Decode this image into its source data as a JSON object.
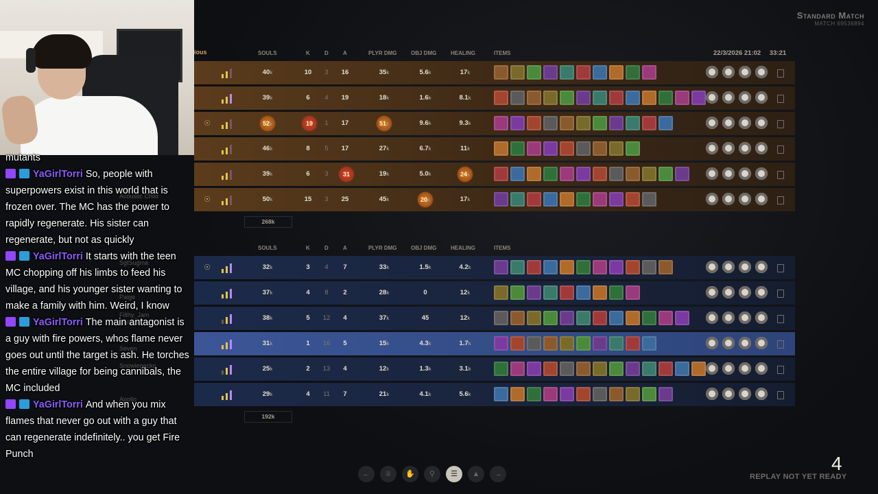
{
  "match": {
    "title": "Standard Match",
    "id": "MATCH 69536894",
    "date": "22/3/2026 21:02",
    "duration": "33:21",
    "team_a_label": "ious"
  },
  "columns": {
    "souls": "SOULS",
    "k": "K",
    "d": "D",
    "a": "A",
    "player_damage": "PLYR DMG",
    "objective_damage": "OBJ DMG",
    "healing": "HEALING",
    "items": "ITEMS"
  },
  "team_a": {
    "total_souls": "268k",
    "players": [
      {
        "souls": "40",
        "k": "10",
        "d": "3",
        "a": "16",
        "pd": "35",
        "od": "5.6",
        "h": "17",
        "bars": [
          1,
          1,
          0
        ]
      },
      {
        "souls": "39",
        "k": "6",
        "d": "4",
        "a": "19",
        "pd": "18",
        "od": "1.6",
        "h": "8.1",
        "bars": [
          1,
          1,
          1
        ]
      },
      {
        "souls": "52",
        "k": "19",
        "d": "1",
        "a": "17",
        "pd": "51",
        "od": "9.6",
        "h": "9.3",
        "bars": [
          1,
          1,
          0
        ]
      },
      {
        "souls": "46",
        "k": "8",
        "d": "5",
        "a": "17",
        "pd": "27",
        "od": "6.7",
        "h": "11",
        "bars": [
          1,
          1,
          0
        ]
      },
      {
        "souls": "39",
        "k": "6",
        "d": "3",
        "a": "31",
        "pd": "19",
        "od": "5.0",
        "h": "24",
        "bars": [
          1,
          1,
          0
        ]
      },
      {
        "souls": "50",
        "k": "15",
        "d": "3",
        "a": "25",
        "pd": "45",
        "od": "20",
        "h": "17",
        "bars": [
          1,
          1,
          0
        ]
      }
    ]
  },
  "team_b": {
    "total_souls": "192k",
    "players": [
      {
        "souls": "32",
        "k": "3",
        "d": "4",
        "a": "7",
        "pd": "33",
        "od": "1.5",
        "h": "4.2",
        "bars": [
          1,
          1,
          1
        ]
      },
      {
        "souls": "37",
        "k": "4",
        "d": "8",
        "a": "2",
        "pd": "28",
        "od": "0",
        "h": "12",
        "bars": [
          1,
          1,
          1
        ]
      },
      {
        "souls": "38",
        "k": "5",
        "d": "12",
        "a": "4",
        "pd": "37",
        "od": "45",
        "h": "12",
        "bars": [
          0,
          1,
          1
        ]
      },
      {
        "souls": "31",
        "k": "1",
        "d": "16",
        "a": "5",
        "pd": "15",
        "od": "4.3",
        "h": "1.7",
        "bars": [
          1,
          1,
          1
        ]
      },
      {
        "souls": "25",
        "k": "2",
        "d": "13",
        "a": "4",
        "pd": "12",
        "od": "1.3",
        "h": "3.1",
        "bars": [
          0,
          1,
          1
        ]
      },
      {
        "souls": "29",
        "k": "4",
        "d": "11",
        "a": "7",
        "pd": "21",
        "od": "4.1",
        "h": "5.6",
        "bars": [
          1,
          1,
          1
        ]
      }
    ]
  },
  "unit_k": "k",
  "replay": {
    "count": "4",
    "text": "REPLAY NOT YET READY"
  },
  "ghost_names": [
    "Acoustic Child",
    "SgtSugma",
    "Filthy_Jam",
    "Celeste",
    "Snowiegecko",
    "Apollo",
    "Paige",
    "Seven"
  ],
  "chat": {
    "top_fragment": "mutants",
    "messages": [
      {
        "user": "YaGirlTorri",
        "text": "So, people with superpowers exist in this world that is frozen over. The MC has the power to rapidly regenerate. His sister can regenerate, but not as quickly"
      },
      {
        "user": "YaGirlTorri",
        "text": "It starts with the teen MC chopping off his limbs to feed his village, and his younger sister wanting to make a family with him. Weird, I know"
      },
      {
        "user": "YaGirlTorri",
        "text": "The main antagonist is a guy with fire powers, whos flame never goes out until the target is ash. He torches the entire village for being cannibals, the MC included"
      },
      {
        "user": "YaGirlTorri",
        "text": "And when you mix flames that never go out with a guy that can regenerate indefinitely.. you get Fire Punch"
      }
    ]
  },
  "colors": {
    "team_a": "#5b3c1c",
    "team_b": "#1c2a4a",
    "highlight": "#3b5597",
    "chat_user": "#8a5cf6"
  },
  "icons": [
    "twitch-badge-icon",
    "crown-badge-icon",
    "back-arrow-icon",
    "trophy-icon",
    "hand-icon",
    "map-pin-icon",
    "list-icon",
    "chart-icon",
    "forward-arrow-icon"
  ]
}
